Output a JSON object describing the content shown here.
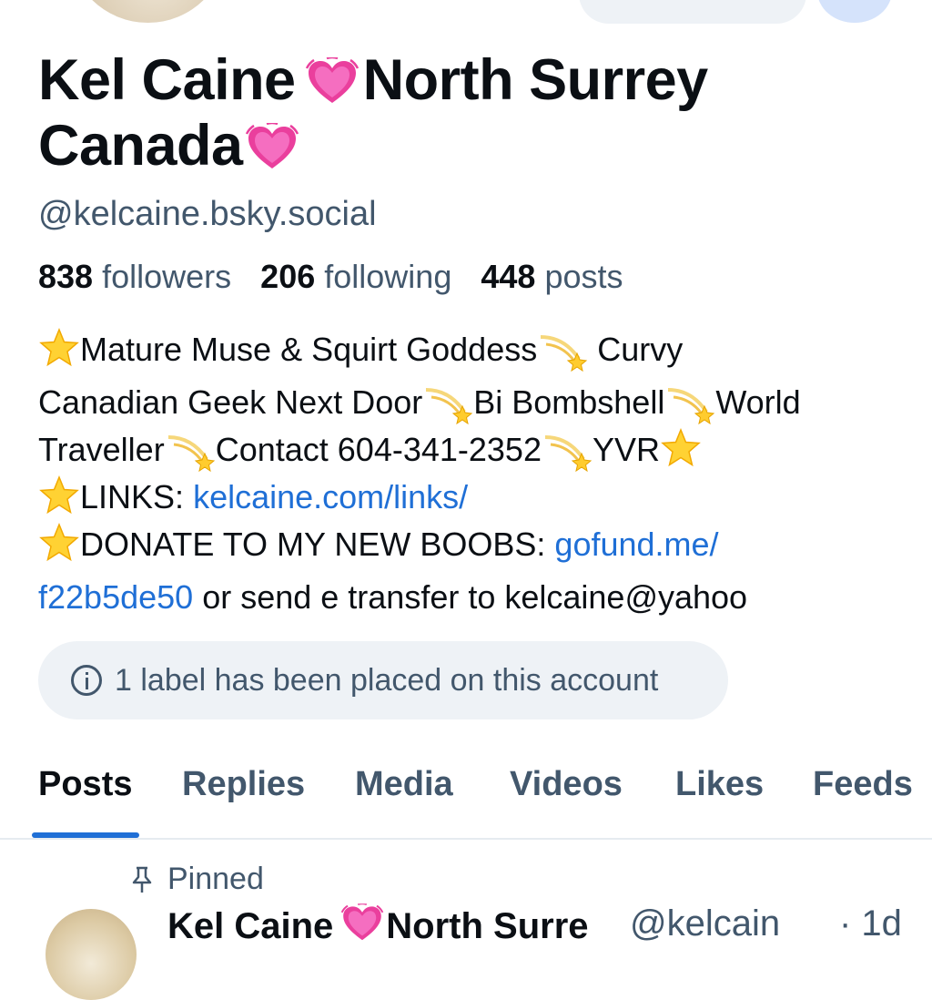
{
  "profile": {
    "name_part1": "Kel Caine",
    "name_part2": "North Surrey",
    "name_part3": "Canada",
    "handle": "@kelcaine.bsky.social",
    "heart_icon": "growing-heart-emoji",
    "accent_color": "#1f6fd6"
  },
  "stats": {
    "followers_count": "838",
    "followers_label": "followers",
    "following_count": "206",
    "following_label": "following",
    "posts_count": "448",
    "posts_label": "posts"
  },
  "bio": {
    "line1_a": "Mature Muse & Squirt Goddess",
    "line1_b": " Curvy",
    "line2_a": "Canadian Geek Next Door",
    "line2_b": "Bi Bombshell",
    "line2_c": "World",
    "line3_a": "Traveller",
    "line3_b": "Contact 604-341-2352",
    "line3_c": "YVR",
    "line4_label": "LINKS: ",
    "line4_link": "kelcaine.com/links/",
    "line5_label": "DONATE TO MY NEW BOOBS: ",
    "line5_link": "gofund.me/",
    "line6_link": "f22b5de50",
    "line6_text": " or send e transfer to kelcaine@yahoo"
  },
  "label_notice": "1 label has been placed on this account",
  "tabs": [
    {
      "label": "Posts",
      "active": true
    },
    {
      "label": "Replies"
    },
    {
      "label": "Media"
    },
    {
      "label": "Videos"
    },
    {
      "label": "Likes"
    },
    {
      "label": "Feeds"
    }
  ],
  "pinned": {
    "label": "Pinned",
    "author_name_a": "Kel Caine",
    "author_name_b": "North Surre",
    "author_handle": "@kelcain",
    "time": "· 1d"
  }
}
